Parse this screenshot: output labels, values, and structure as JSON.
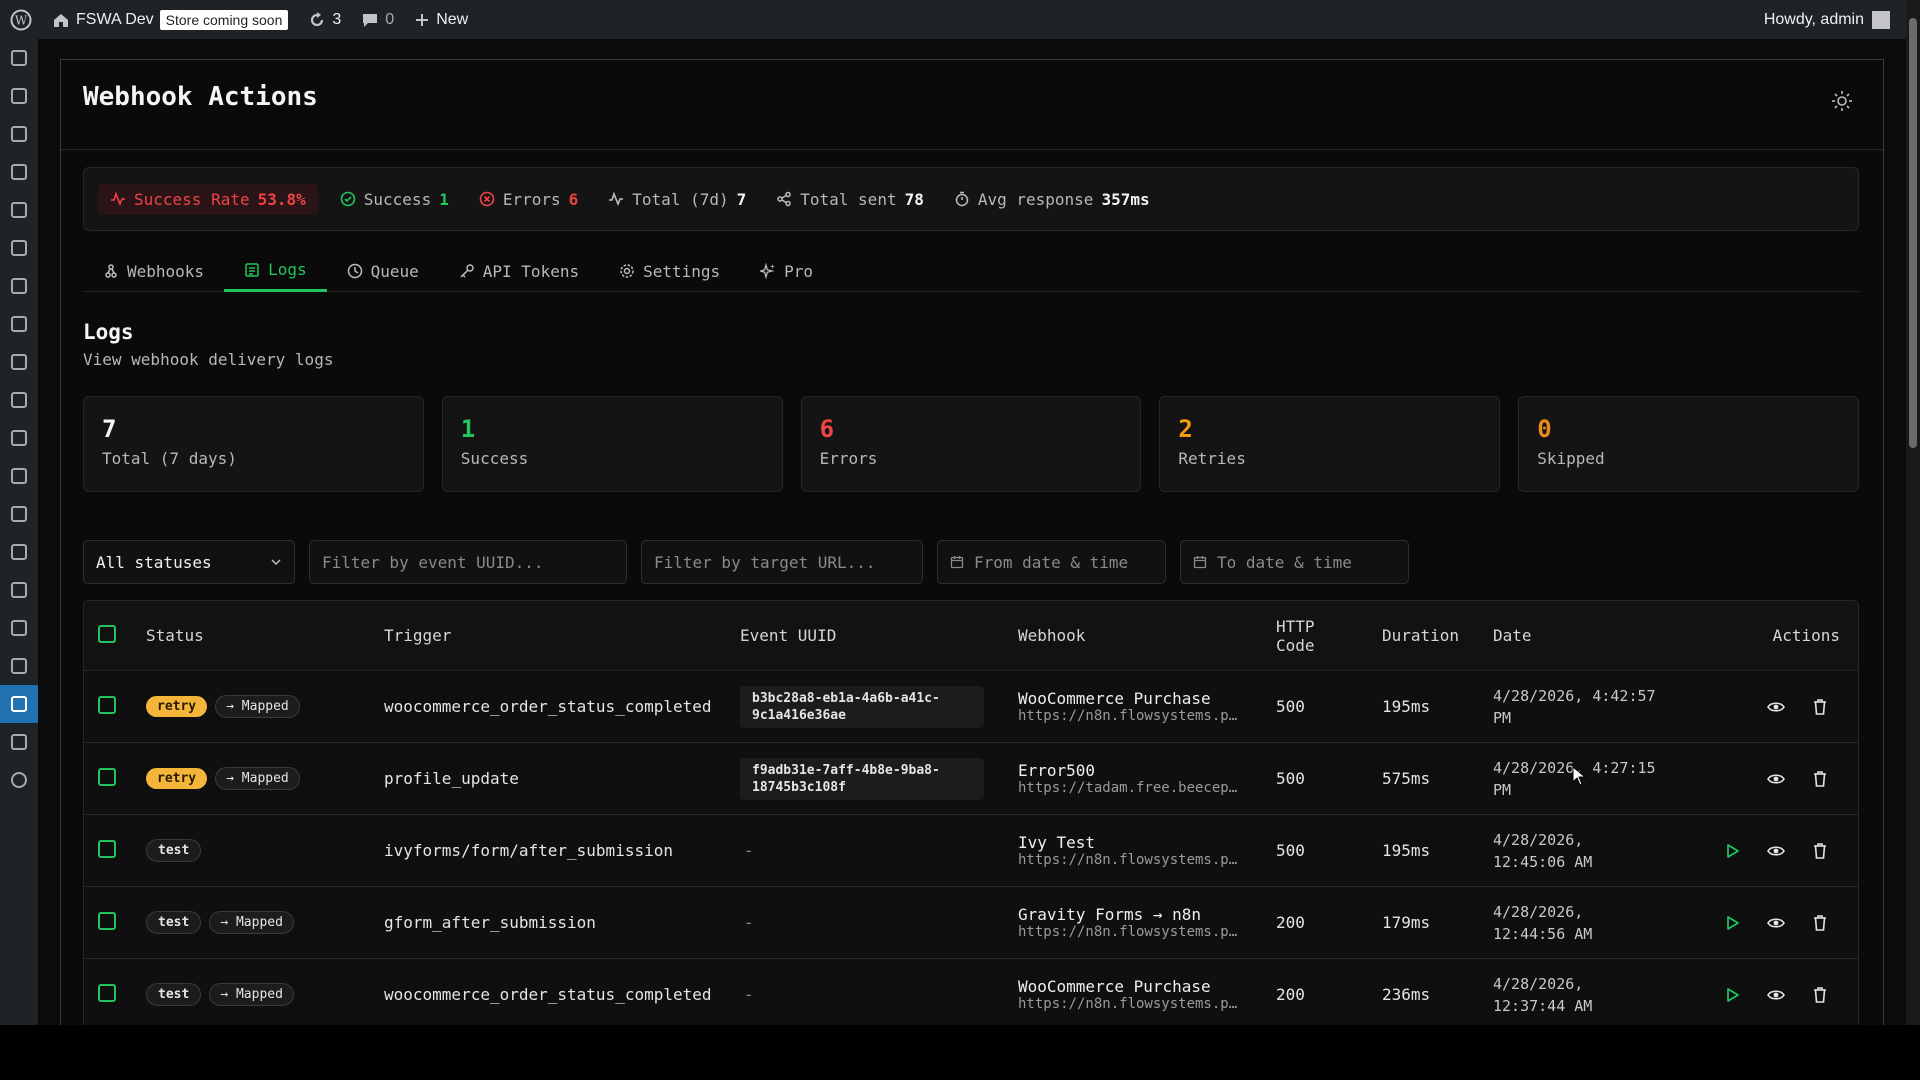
{
  "adminbar": {
    "site_name": "FSWA Dev",
    "store_badge": "Store coming soon",
    "updates_count": "3",
    "comments_count": "0",
    "new_label": "New",
    "howdy": "Howdy, admin"
  },
  "page": {
    "title": "Webhook Actions"
  },
  "stats": {
    "success_rate_label": "Success Rate",
    "success_rate_value": "53.8%",
    "success_label": "Success",
    "success_value": "1",
    "errors_label": "Errors",
    "errors_value": "6",
    "total_label": "Total (7d)",
    "total_value": "7",
    "total_sent_label": "Total sent",
    "total_sent_value": "78",
    "avg_label": "Avg response",
    "avg_value": "357ms"
  },
  "tabs": [
    {
      "label": "Webhooks"
    },
    {
      "label": "Logs"
    },
    {
      "label": "Queue"
    },
    {
      "label": "API Tokens"
    },
    {
      "label": "Settings"
    },
    {
      "label": "Pro"
    }
  ],
  "section": {
    "title": "Logs",
    "subtitle": "View webhook delivery logs"
  },
  "cards": [
    {
      "value": "7",
      "label": "Total (7 days)"
    },
    {
      "value": "1",
      "label": "Success"
    },
    {
      "value": "6",
      "label": "Errors"
    },
    {
      "value": "2",
      "label": "Retries"
    },
    {
      "value": "0",
      "label": "Skipped"
    }
  ],
  "filters": {
    "status_value": "All statuses",
    "uuid_placeholder": "Filter by event UUID...",
    "url_placeholder": "Filter by target URL...",
    "from_label": "From date & time",
    "to_label": "To date & time"
  },
  "table": {
    "headers": {
      "status": "Status",
      "trigger": "Trigger",
      "uuid": "Event UUID",
      "webhook": "Webhook",
      "http_line1": "HTTP",
      "http_line2": "Code",
      "duration": "Duration",
      "date": "Date",
      "actions": "Actions"
    },
    "rows": [
      {
        "status": "retry",
        "mapped": "Mapped",
        "trigger": "woocommerce_order_status_completed",
        "uuid_line1": "b3bc28a8-eb1a-4a6b-a41c-",
        "uuid_line2": "9c1a416e36ae",
        "webhook_name": "WooCommerce Purchase",
        "webhook_url": "https://n8n.flowsystems.pl…",
        "http": "500",
        "duration": "195ms",
        "date_line1": "4/28/2026, 4:42:57",
        "date_line2": "PM"
      },
      {
        "status": "retry",
        "mapped": "Mapped",
        "trigger": "profile_update",
        "uuid_line1": "f9adb31e-7aff-4b8e-9ba8-",
        "uuid_line2": "18745b3c108f",
        "webhook_name": "Error500",
        "webhook_url": "https://tadam.free.beecept…",
        "http": "500",
        "duration": "575ms",
        "date_line1": "4/28/2026, 4:27:15",
        "date_line2": "PM"
      },
      {
        "status": "test",
        "mapped": "",
        "trigger": "ivyforms/form/after_submission",
        "uuid_dash": "-",
        "webhook_name": "Ivy Test",
        "webhook_url": "https://n8n.flowsystems.pl…",
        "http": "500",
        "duration": "195ms",
        "date_line1": "4/28/2026,",
        "date_line2": "12:45:06 AM"
      },
      {
        "status": "test",
        "mapped": "Mapped",
        "trigger": "gform_after_submission",
        "uuid_dash": "-",
        "webhook_name": "Gravity Forms → n8n",
        "webhook_url": "https://n8n.flowsystems.pl…",
        "http": "200",
        "duration": "179ms",
        "date_line1": "4/28/2026,",
        "date_line2": "12:44:56 AM"
      },
      {
        "status": "test",
        "mapped": "Mapped",
        "trigger": "woocommerce_order_status_completed",
        "uuid_dash": "-",
        "webhook_name": "WooCommerce Purchase",
        "webhook_url": "https://n8n.flowsystems.pl…",
        "http": "200",
        "duration": "236ms",
        "date_line1": "4/28/2026,",
        "date_line2": "12:37:44 AM"
      }
    ]
  },
  "colors": {
    "accent": "#22c55e",
    "error": "#ef4444",
    "retry": "#f5b53b",
    "wp_blue": "#2271b1"
  }
}
